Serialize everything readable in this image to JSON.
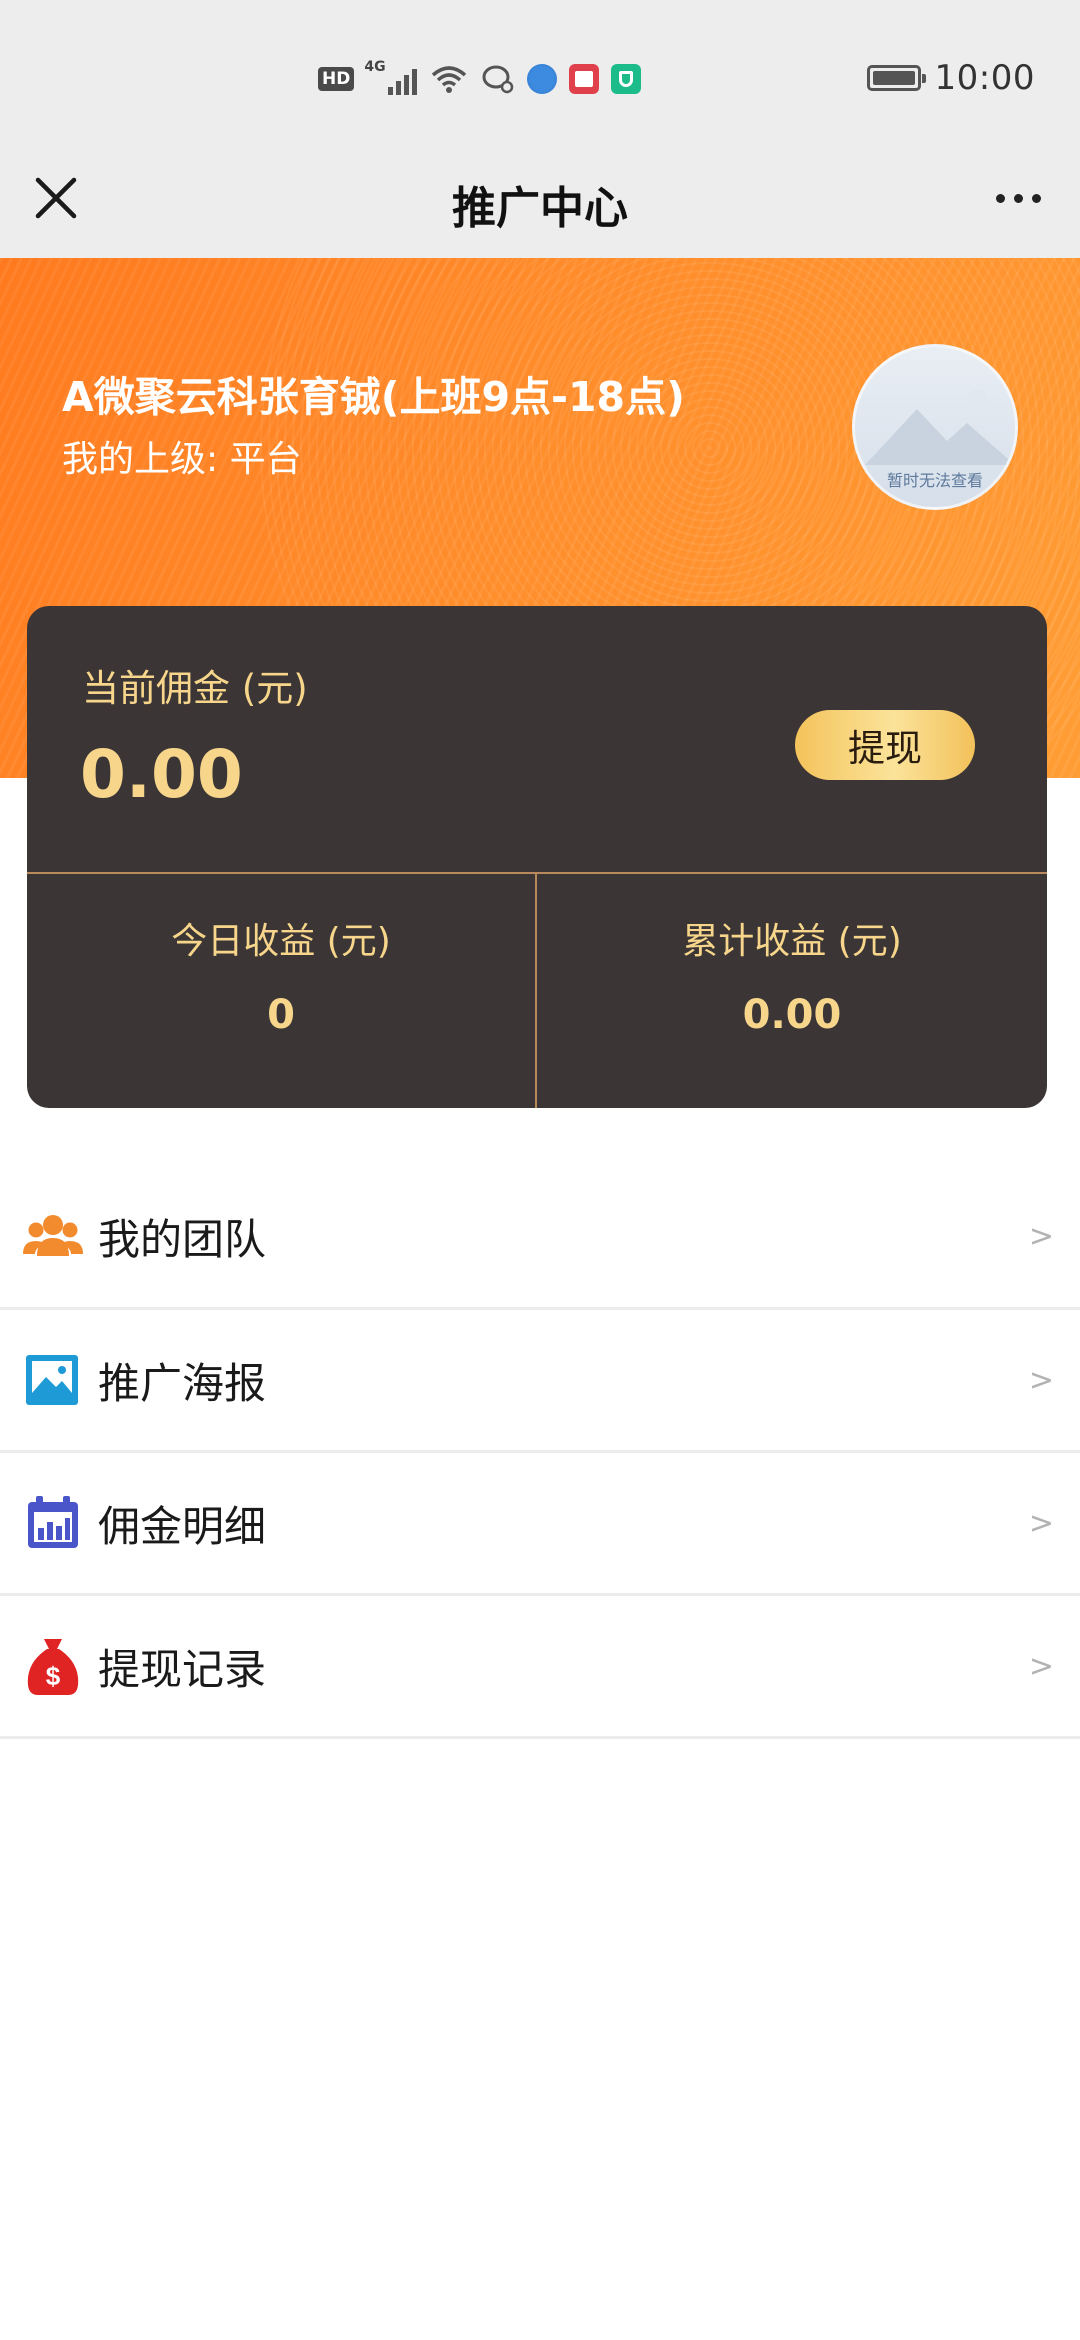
{
  "status_bar": {
    "network_label": "HD",
    "signal_label": "4G",
    "time": "10:00",
    "icons": [
      "hd-icon",
      "signal-icon",
      "wifi-icon",
      "chat-bubble-icon",
      "browser-icon",
      "reader-app-icon",
      "shield-app-icon",
      "battery-icon"
    ]
  },
  "nav": {
    "title": "推广中心",
    "close_icon": "close-icon",
    "more_icon": "more-icon"
  },
  "profile": {
    "name": "A微聚云科张育铖(上班9点-18点)",
    "supervisor": "我的上级: 平台",
    "avatar_placeholder": "暂时无法查看"
  },
  "earnings": {
    "current_label": "当前佣金 (元)",
    "current_value": "0.00",
    "withdraw_label": "提现",
    "today_label": "今日收益 (元)",
    "today_value": "0",
    "total_label": "累计收益 (元)",
    "total_value": "0.00"
  },
  "menu": [
    {
      "label": "我的团队",
      "icon": "team-icon",
      "arrow": ">"
    },
    {
      "label": "推广海报",
      "icon": "poster-icon",
      "arrow": ">"
    },
    {
      "label": "佣金明细",
      "icon": "calendar-chart-icon",
      "arrow": ">"
    },
    {
      "label": "提现记录",
      "icon": "money-bag-icon",
      "arrow": ">"
    }
  ],
  "colors": {
    "banner_orange": "#ff8c2a",
    "card_dark": "#3b3635",
    "gold_text": "#f7d68c",
    "team_icon": "#f28a2e",
    "poster_icon": "#1e9ad6",
    "calendar_icon": "#4a55c9",
    "money_icon": "#e02424"
  }
}
